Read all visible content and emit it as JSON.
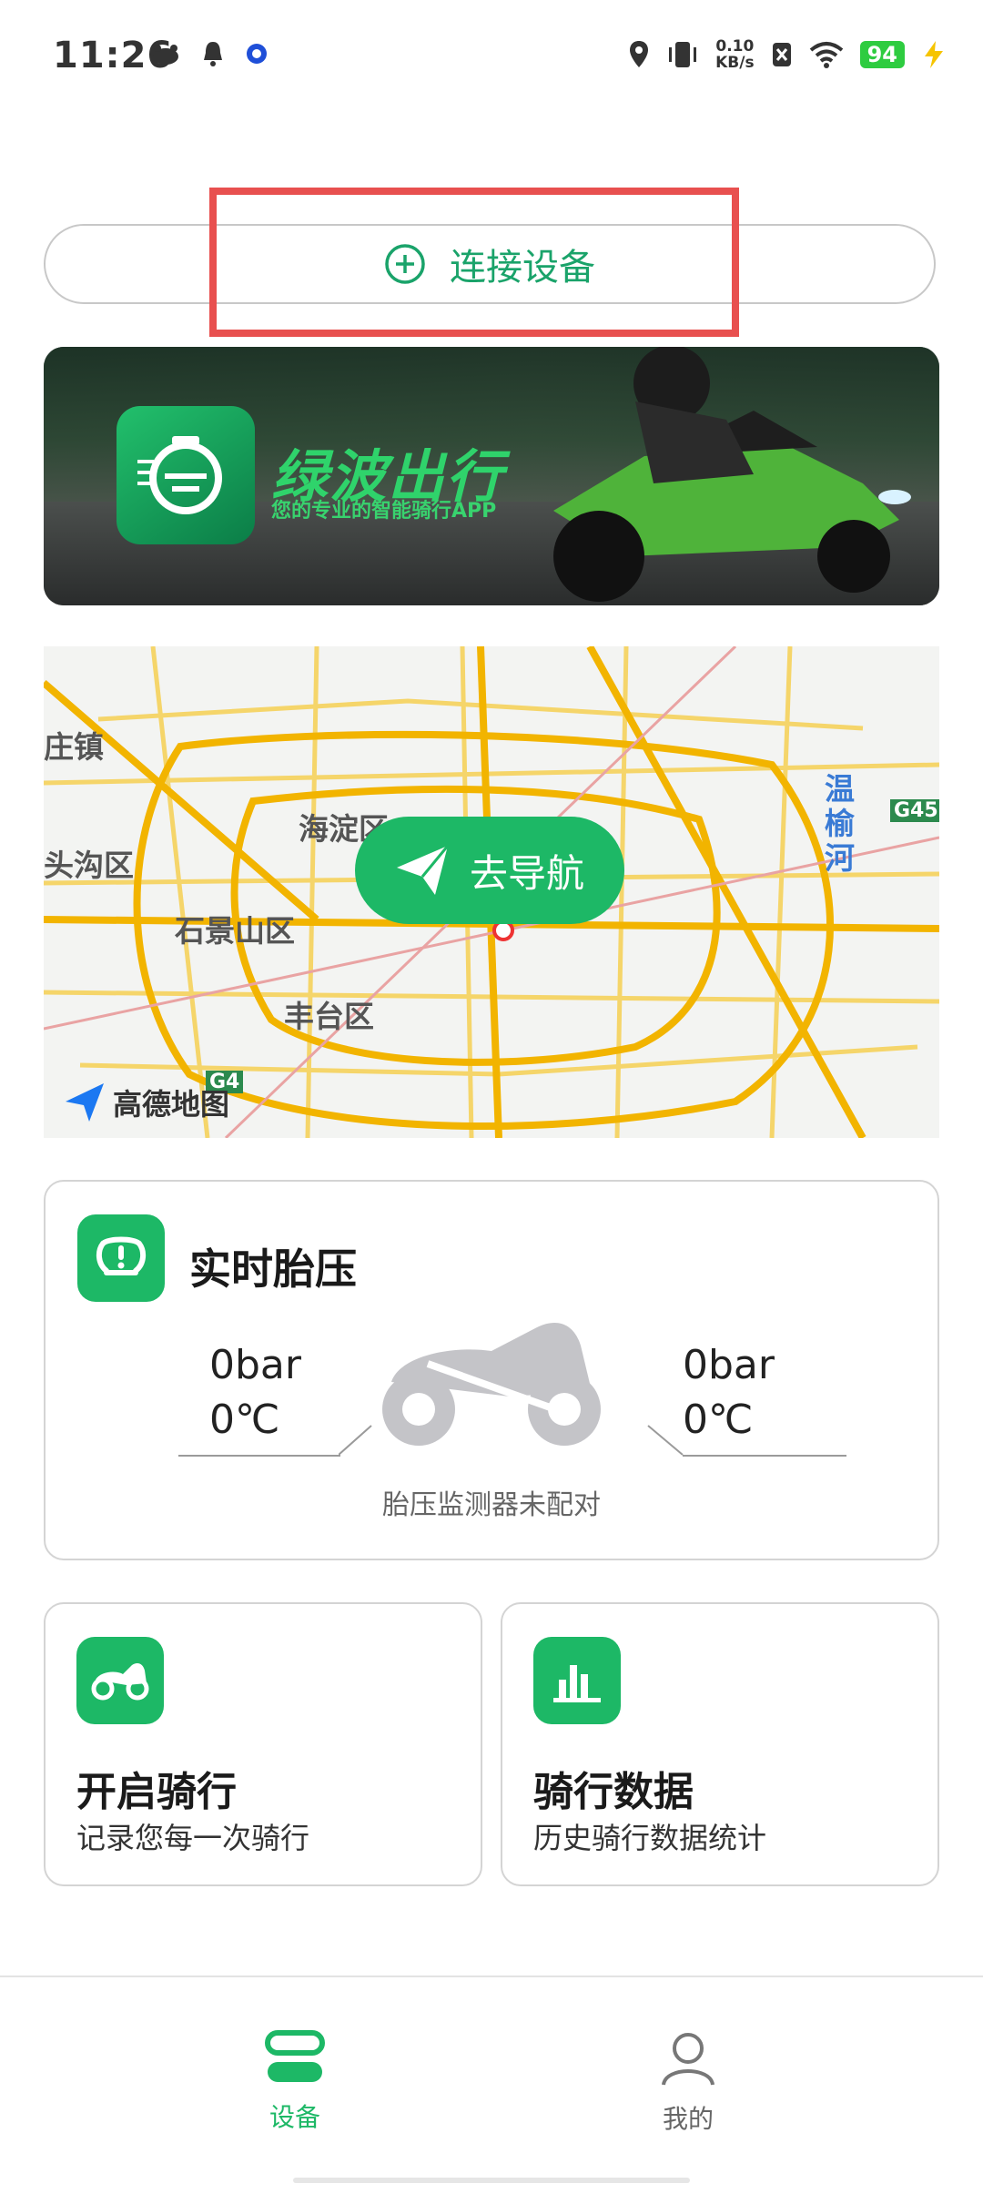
{
  "status_bar": {
    "time": "11:26",
    "net_speed_value": "0.10",
    "net_speed_unit": "KB/s",
    "battery": "94",
    "icons": [
      "cat-icon",
      "bell-icon",
      "circle-app-icon",
      "location-icon",
      "vibrate-icon",
      "no-sim-icon",
      "wifi-icon",
      "charging-icon"
    ]
  },
  "connect": {
    "label": "连接设备",
    "icon": "plus-circle-icon",
    "accent": "#1aa36a",
    "highlight_color": "#e8504f"
  },
  "banner": {
    "brand_title": "绿波出行",
    "brand_subtitle": "您的专业的智能骑行APP"
  },
  "map": {
    "labels": [
      "庄镇",
      "海淀区",
      "头沟区",
      "石景山区",
      "丰台区",
      "温",
      "榆",
      "河",
      "G45",
      "G4"
    ],
    "nav_button": "去导航",
    "provider": "高德地图"
  },
  "tire": {
    "title": "实时胎压",
    "front_pressure": "0bar",
    "front_temp": "0℃",
    "rear_pressure": "0bar",
    "rear_temp": "0℃",
    "status": "胎压监测器未配对"
  },
  "features": [
    {
      "title": "开启骑行",
      "subtitle": "记录您每一次骑行",
      "icon": "motorcycle-icon"
    },
    {
      "title": "骑行数据",
      "subtitle": "历史骑行数据统计",
      "icon": "bar-chart-icon"
    }
  ],
  "bottom_nav": [
    {
      "label": "设备",
      "icon": "device-icon",
      "active": true,
      "color": "#1db866"
    },
    {
      "label": "我的",
      "icon": "user-icon",
      "active": false,
      "color": "#666666"
    }
  ]
}
